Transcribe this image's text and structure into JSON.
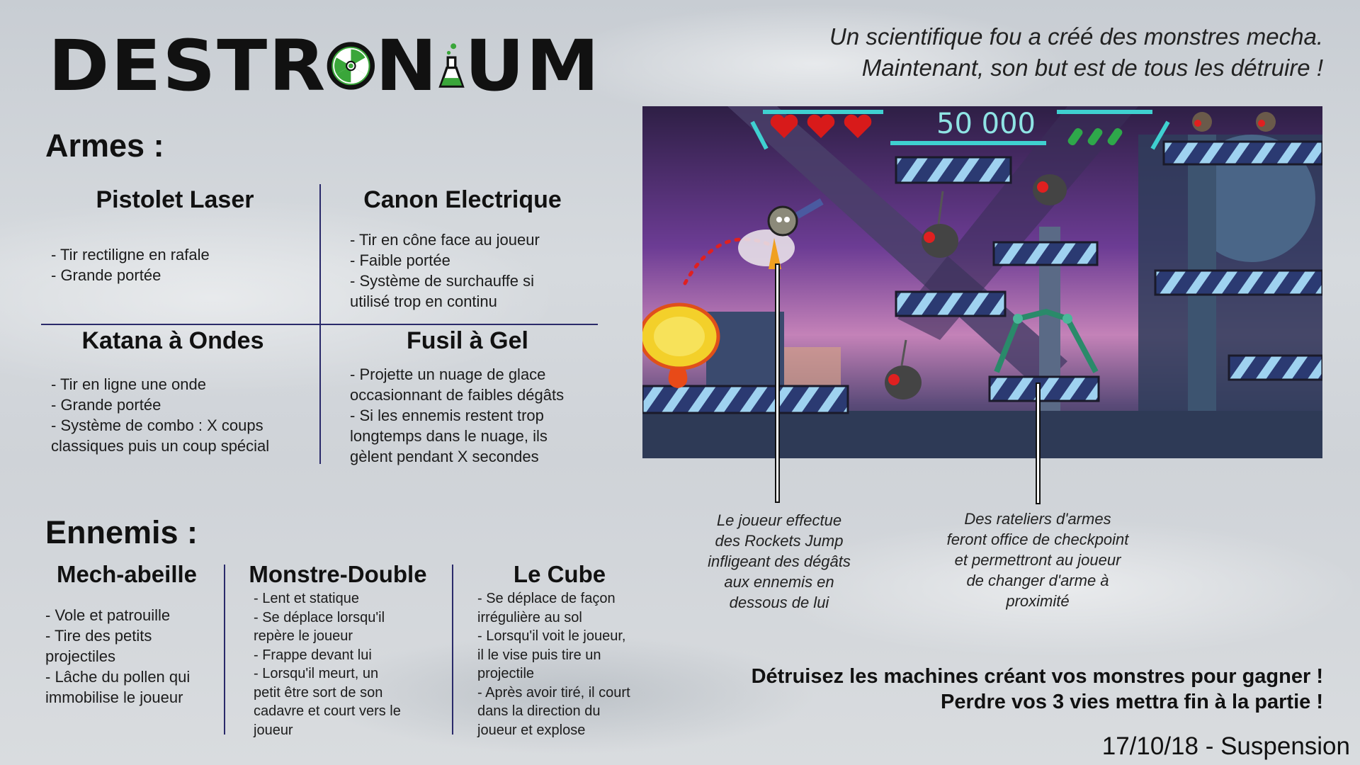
{
  "logo": {
    "text_left": "DESTR",
    "text_mid": "N",
    "text_right": "UM"
  },
  "tagline": {
    "line1": "Un scientifique fou a créé des monstres mecha.",
    "line2": "Maintenant, son but est de tous les détruire !"
  },
  "armes": {
    "title": "Armes :",
    "items": [
      {
        "name": "Pistolet Laser",
        "desc": "- Tir rectiligne en rafale\n- Grande portée"
      },
      {
        "name": "Canon Electrique",
        "desc": "- Tir en cône face au joueur\n- Faible portée\n- Système de surchauffe si\nutilisé trop en continu"
      },
      {
        "name": "Katana à Ondes",
        "desc": "- Tir en ligne une onde\n- Grande portée\n- Système de combo : X coups\nclassiques puis un coup spécial"
      },
      {
        "name": "Fusil à Gel",
        "desc": "- Projette un nuage de glace\noccasionnant de faibles dégâts\n- Si les ennemis restent trop\nlongtemps dans le nuage, ils\ngèlent pendant X secondes"
      }
    ]
  },
  "ennemis": {
    "title": "Ennemis :",
    "items": [
      {
        "name": "Mech-abeille",
        "desc": "- Vole et patrouille\n- Tire des petits\nprojectiles\n- Lâche du pollen qui\nimmobilise le joueur"
      },
      {
        "name": "Monstre-Double",
        "desc": "- Lent et statique\n- Se déplace lorsqu'il\nrepère le joueur\n- Frappe devant lui\n- Lorsqu'il meurt, un\npetit être sort de son\ncadavre et court vers le\njoueur"
      },
      {
        "name": "Le Cube",
        "desc": "- Se déplace de façon\nirrégulière au sol\n- Lorsqu'il voit le joueur,\nil le vise puis tire un\nprojectile\n- Après avoir tiré, il court\ndans la direction du\njoueur et explose"
      }
    ]
  },
  "game": {
    "score": "50 000",
    "lives": 3,
    "ammo": 3
  },
  "callouts": {
    "rocket": "Le joueur effectue\ndes Rockets Jump\ninfligeant des dégâts\naux ennemis en\ndessous de lui",
    "rack": "Des rateliers d'armes\nferont office de checkpoint\net permettront au joueur\nde changer d'arme à\nproximité"
  },
  "goal": {
    "line1": "Détruisez les machines créant vos monstres pour gagner !",
    "line2": "Perdre vos 3 vies mettra fin à la partie !"
  },
  "footer": {
    "date": "17/10/18 - Suspension"
  },
  "colors": {
    "accent_green": "#3aa63a",
    "divider": "#2a2a6a",
    "hud_cyan": "#3fd0d0",
    "heart_red": "#d81a1a"
  }
}
